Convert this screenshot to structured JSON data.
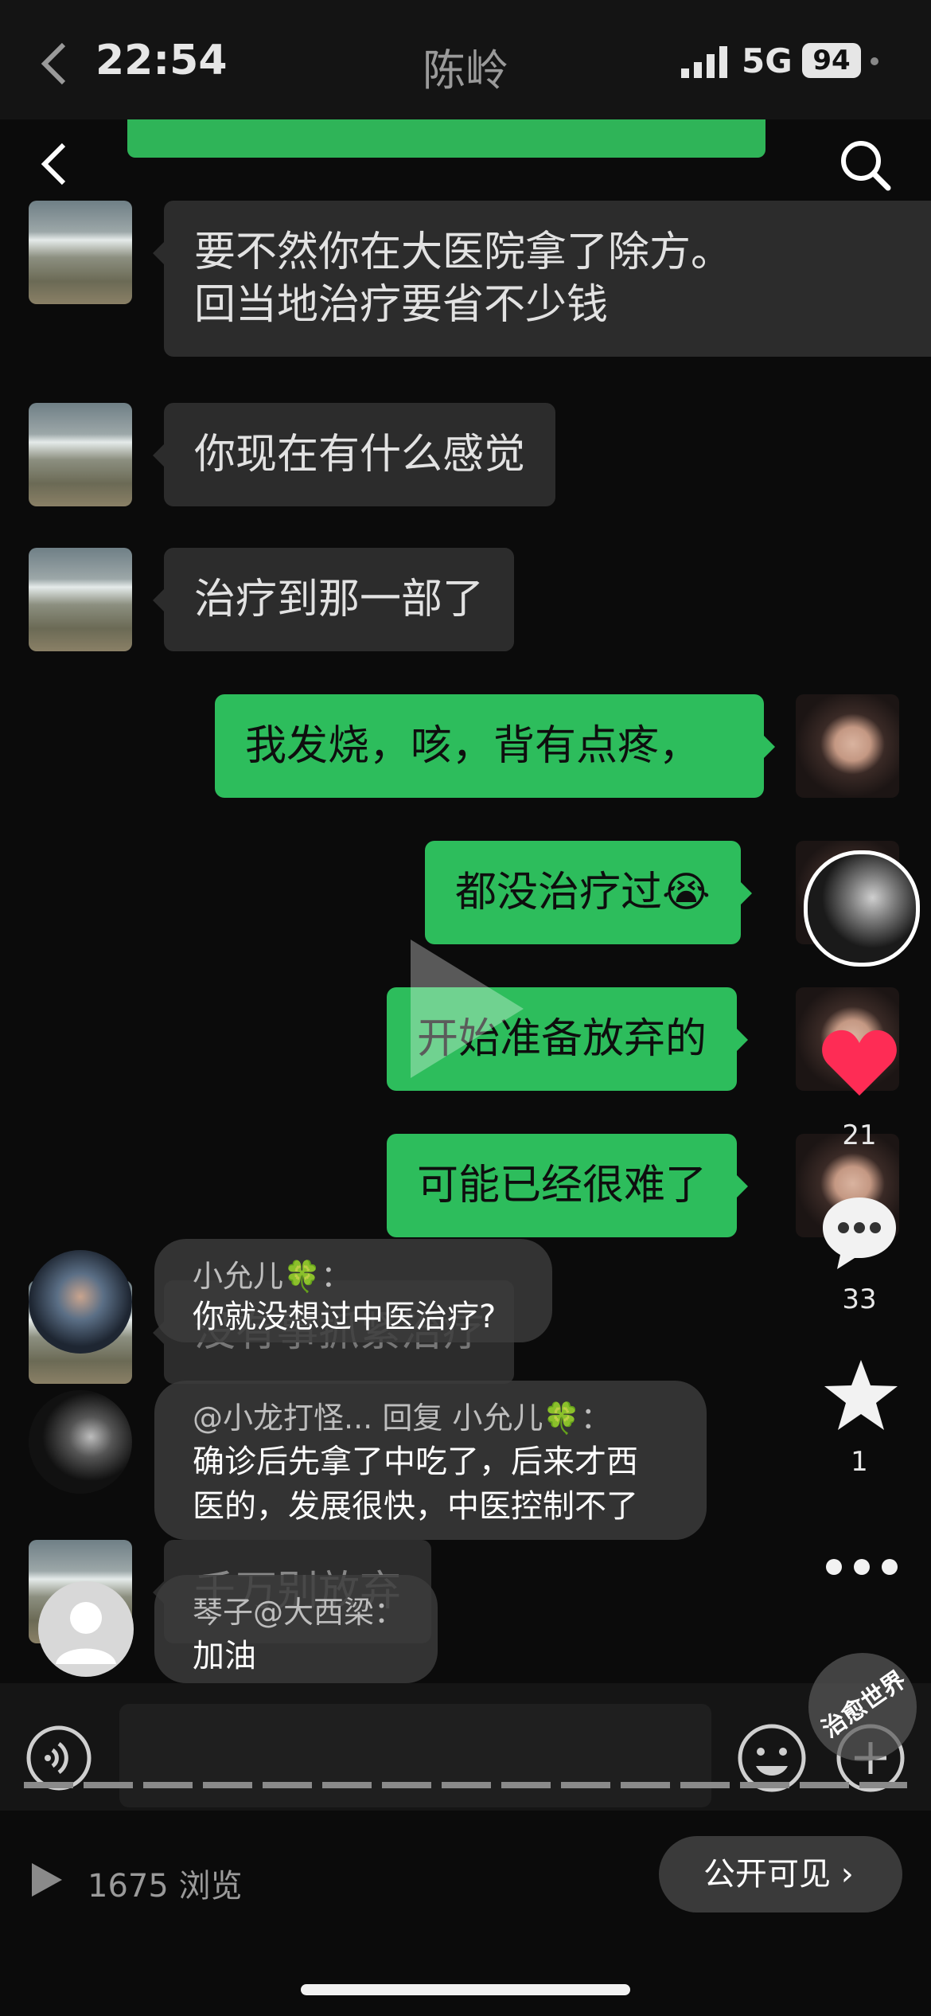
{
  "status_bar": {
    "time": "22:54",
    "title": "陈岭",
    "network": "5G",
    "battery": "94"
  },
  "messages": [
    {
      "side": "left",
      "text_lines": [
        "要不然你在大医院拿了除方。",
        "回当地治疗要省不少钱"
      ]
    },
    {
      "side": "left",
      "text_lines": [
        "你现在有什么感觉"
      ]
    },
    {
      "side": "left",
      "text_lines": [
        "治疗到那一部了"
      ]
    },
    {
      "side": "right",
      "text_lines": [
        "我发烧，咳，背有点疼，"
      ]
    },
    {
      "side": "right",
      "text_lines": [
        "都没治疗过😭"
      ]
    },
    {
      "side": "right",
      "text_lines": [
        "开始准备放弃的"
      ]
    },
    {
      "side": "right",
      "text_lines": [
        "可能已经很难了"
      ]
    },
    {
      "side": "left",
      "text_lines": [
        "没有事抓紧治疗"
      ]
    },
    {
      "side": "left",
      "text_lines": [
        "千万别放弃"
      ]
    }
  ],
  "comments": [
    {
      "user": "小允儿🍀：",
      "text_lines": [
        "你就没想过中医治疗?"
      ]
    },
    {
      "user": "@小龙打怪... 回复 小允儿🍀：",
      "text_lines": [
        "确诊后先拿了中吃了，后来才西",
        "医的，发展很快，中医控制不了"
      ]
    },
    {
      "user": "琴子@大西梁：",
      "text_lines": [
        "加油"
      ]
    }
  ],
  "sidebar": {
    "likes": "21",
    "comments": "33",
    "favorites": "1"
  },
  "watermark": "治愈世界",
  "bottom": {
    "views": "1675 浏览",
    "visibility_button": "公开可见 ›"
  }
}
